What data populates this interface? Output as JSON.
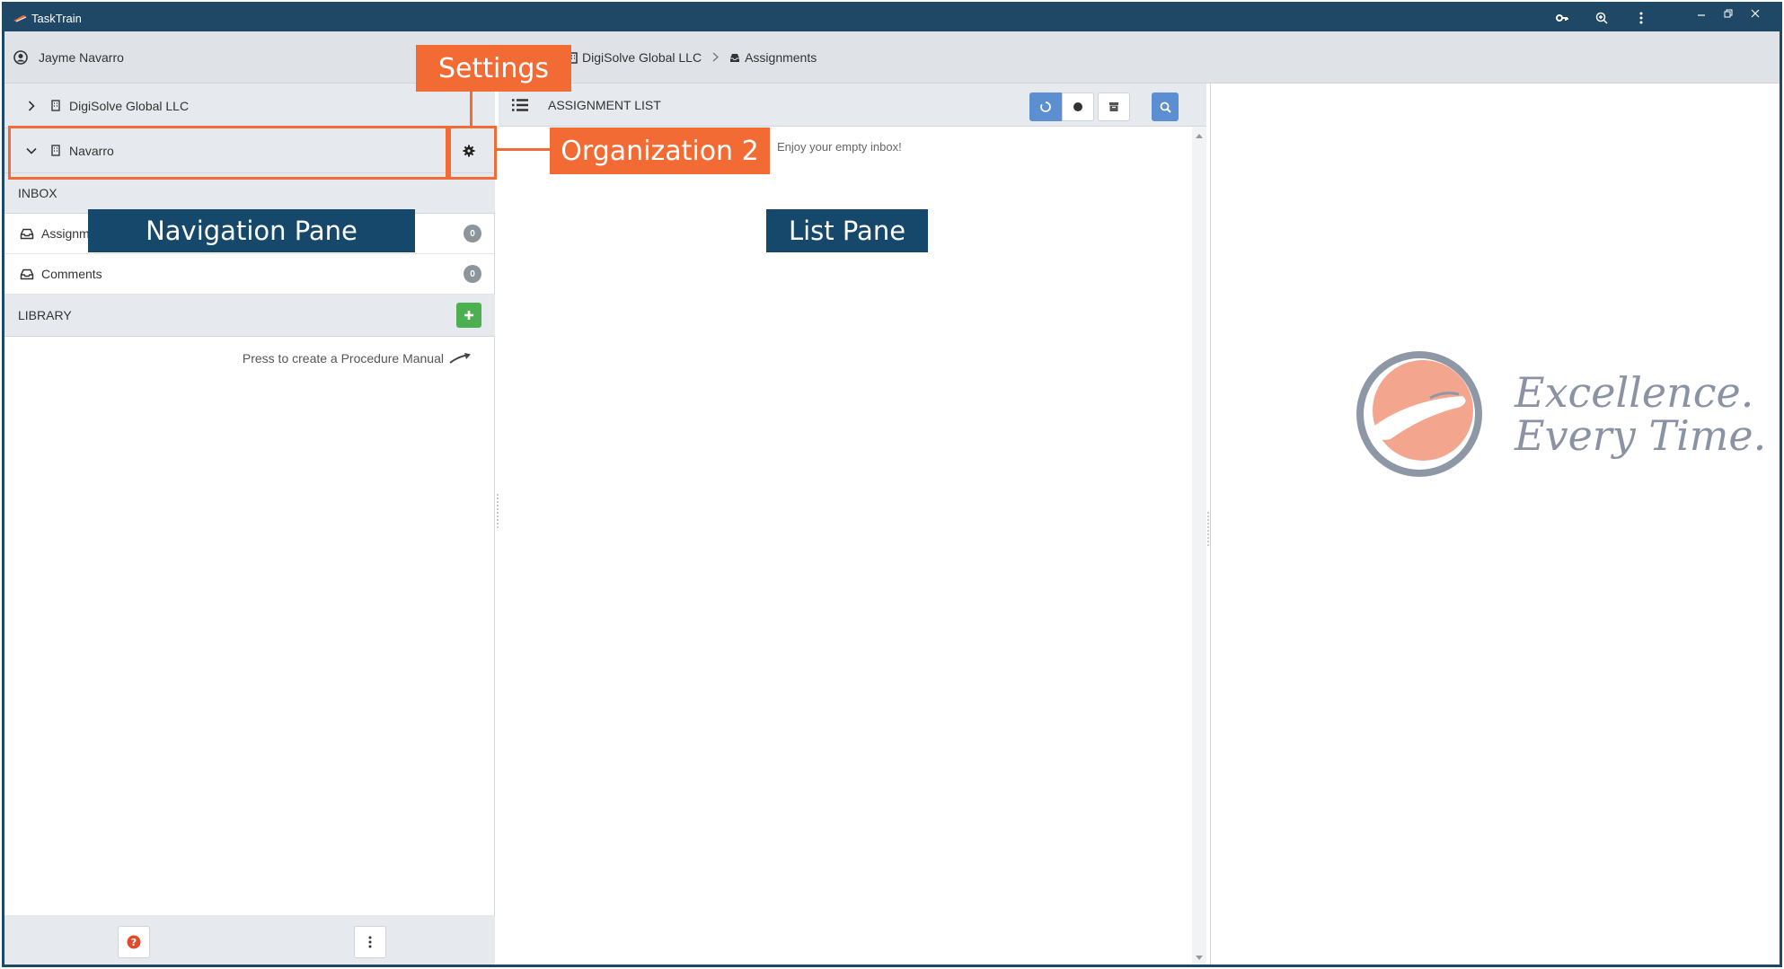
{
  "window": {
    "title": "TaskTrain",
    "icons": [
      "key-icon",
      "zoom-icon",
      "more-vertical-icon"
    ],
    "controls": [
      "minimize-icon",
      "restore-icon",
      "close-icon"
    ]
  },
  "header": {
    "user_name": "Jayme Navarro",
    "breadcrumb": [
      {
        "label": "DigiSolve Global LLC",
        "icon": "building-icon"
      },
      {
        "label": "Assignments",
        "icon": "inbox-icon"
      }
    ]
  },
  "nav": {
    "organizations": [
      {
        "name": "DigiSolve Global LLC",
        "expanded": false
      },
      {
        "name": "Navarro",
        "expanded": true
      }
    ],
    "inbox": {
      "title": "INBOX",
      "items": [
        {
          "label": "Assignments",
          "count": "0"
        },
        {
          "label": "Comments",
          "count": "0"
        }
      ]
    },
    "library": {
      "title": "LIBRARY",
      "hint": "Press to create a Procedure Manual"
    }
  },
  "list": {
    "title": "ASSIGNMENT LIST",
    "empty_message": "Enjoy your empty inbox!"
  },
  "detail": {
    "tagline_line1": "Excellence.",
    "tagline_line2": "Every Time."
  },
  "annotations": {
    "settings": "Settings",
    "organization": "Organization 2",
    "navigation_pane": "Navigation Pane",
    "list_pane": "List Pane"
  },
  "colors": {
    "titlebar": "#1f4766",
    "annotation_orange": "#f26b35",
    "annotation_navy": "#15486b",
    "add_button": "#4caf50",
    "active_toggle": "#5b8fd1",
    "badge": "#8c949c"
  }
}
